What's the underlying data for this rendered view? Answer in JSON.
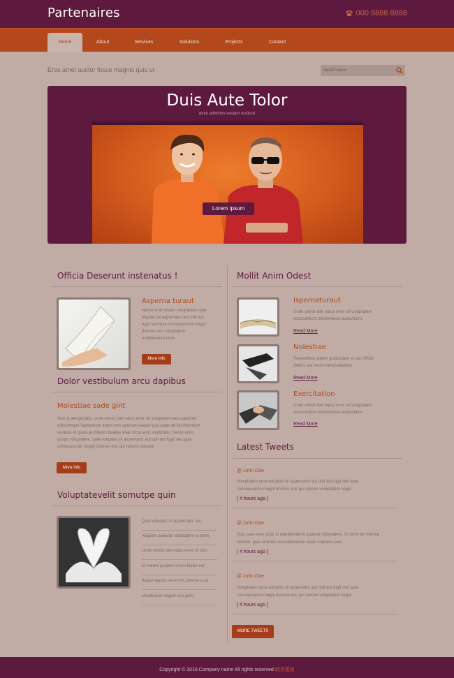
{
  "header": {
    "logo": "Partenaires",
    "phone": "000 8888 8888"
  },
  "nav": [
    {
      "label": "Home",
      "active": true
    },
    {
      "label": "About"
    },
    {
      "label": "Services"
    },
    {
      "label": "Solutions"
    },
    {
      "label": "Projects"
    },
    {
      "label": "Contact"
    }
  ],
  "tagline": "Eros amet auctor fusce magnis quis ut",
  "search": {
    "placeholder": "Search here"
  },
  "hero": {
    "title": "Duis Aute Tolor",
    "subtitle": "enim adminim veniam nostrud",
    "button": "Lorem ipsum"
  },
  "left": {
    "section1": {
      "title": "Officia Deserunt instenatus !",
      "item_title": "Asperna turaut",
      "item_text": [
        "Nemo enim ipsam voluptatem quia",
        "oluptas sit aspernatur aut odit aut",
        "fugit sed quia consequuntur magni",
        "dolores eos voluptatem",
        "ondimentum enim ."
      ],
      "button": "More Info"
    },
    "section2": {
      "title": "Dolor vestibulum arcu dapibus",
      "item_title": "Molestiae sade gint",
      "item_text": [
        "Sed ut perspiciatis, unde omnis iste natus error sit voluptatem accusantium",
        "doloremque laudantium totam rem aperiam eaque ipsa quae ab illo inventore",
        "veritatis et quasi architecto beatae vitae dicta sunt, explicabo. Nemo enim",
        "ipsam voluptatem, quia voluptas sit aspernatur aut odit aut fugit sed quia",
        "consequuntur magni dolores eos qui ratione volupta"
      ],
      "button": "More Info"
    },
    "section3": {
      "title": "Voluptatevelit somutpe quin",
      "list": [
        "Quia voluptas sit aspernatur aut",
        "Aliquam quaerat voluptatem ut enim",
        "Unde omnis iste natus error sit volu",
        "Et harum quidem rerum facilis est",
        "Itaque earum rerum hic tenetur a sa",
        "Vestibulum aliquet orci justo"
      ]
    }
  },
  "right": {
    "section1": {
      "title": "Mollit Anim Odest",
      "items": [
        {
          "title": "Ispernaturaut",
          "text": [
            "Unde omnis iste natus error sit voluptatem",
            "accusantium doloremque laudantium."
          ],
          "link": "Read More"
        },
        {
          "title": "Nolestiae",
          "text": [
            "Temporibus autem quibusdam et aut officiis",
            "debitis aut rerum necessitatibus"
          ],
          "link": "Read More"
        },
        {
          "title": "Exercitation",
          "text": [
            "Unde omnis iste natus error sit voluptatem",
            "accusantium doloremque laudantium."
          ],
          "link": "Read More"
        }
      ]
    },
    "tweets": {
      "title": "Latest Tweets",
      "items": [
        {
          "name": "@ John Doe",
          "text": [
            "Voluptatem quia voluptas sit aspernatur aut odit aut fugit sed quia",
            "consequuntur magni dolores eos qui ratione voluptatem sequi."
          ],
          "time": "[ 4 hours ago ]"
        },
        {
          "name": "@ John Doe",
          "text": [
            "Duis aute irure dolor in reprehenderit quaerat voluptatem. Ut enim ad minima",
            "veniam, quis nostrum exercitationem ullam corporis susc."
          ],
          "time": "[ 4 hours ago ]"
        },
        {
          "name": "@ John Doe",
          "text": [
            "Voluptatem quia voluptas sit aspernatur aut odit aut fugit sed quia",
            "consequuntur magni dolores eos qui ratione voluptatem sequi."
          ],
          "time": "[ 4 hours ago ]"
        }
      ],
      "button": "MORE TWEETS"
    }
  },
  "footer": {
    "text": "Copyright © 2016.Company name All rights reserved.",
    "link": "网页模板"
  }
}
